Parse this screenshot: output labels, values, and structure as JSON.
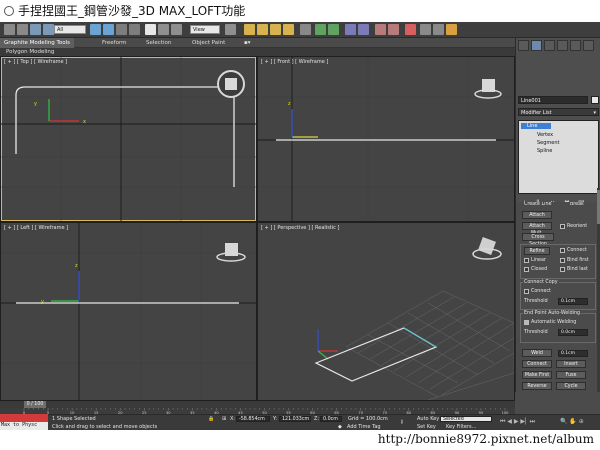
{
  "page_title": "手捏捏國王_鋼管沙發_3D MAX_LOFT功能",
  "toolbar": {
    "selection_filter": "All",
    "ref_coord": "View"
  },
  "ribbon": {
    "tabs": [
      "Graphite Modeling Tools",
      "Freeform",
      "Selection",
      "Object Paint"
    ],
    "active_tab_index": 0,
    "sub_label": "Polygon Modeling"
  },
  "viewports": {
    "top": "[ + ] [ Top ] [ Wireframe ]",
    "front": "[ + ] [ Front ] [ Wireframe ]",
    "left": "[ + ] [ Left ] [ Wireframe ]",
    "perspective": "[ + ] [ Perspective ] [ Realistic ]"
  },
  "command_panel": {
    "object_name": "Line001",
    "object_color": "#e8e8e8",
    "modifier_list": "Modifier List",
    "stack": [
      {
        "label": "Line",
        "selected": true
      },
      {
        "label": "Vertex",
        "selected": false
      },
      {
        "label": "Segment",
        "selected": false
      },
      {
        "label": "Spline",
        "selected": false
      }
    ],
    "partial_top_left": "Create Line",
    "partial_top_right": "Break",
    "attach": "Attach",
    "attach_mult": "Attach Mult.",
    "reorient": "Reorient",
    "cross_section": "Cross Section",
    "refine": "Refine",
    "connect": "Connect",
    "linear": "Linear",
    "bind_first": "Bind first",
    "closed": "Closed",
    "bind_last": "Bind last",
    "connect_copy": "Connect Copy",
    "connect_copy_cb": "Connect",
    "threshold": "Threshold",
    "threshold_val": "0.1cm",
    "end_point_welding": "End Point Auto-Welding",
    "automatic_welding": "Automatic Welding",
    "threshold2": "Threshold",
    "threshold2_val": "0.0cm",
    "weld": "Weld",
    "weld_val": "0.1cm",
    "connect_btn": "Connect",
    "insert": "Insert",
    "make_first": "Make First",
    "fuse": "Fuse",
    "reverse": "Reverse",
    "cycle": "Cycle",
    "crossinsert": "CrossInsert",
    "crossinsert_val": "0.1cm",
    "fillet": "Fillet",
    "fillet_val": "0.0cm",
    "chamfer": "Chamfer",
    "chamfer_val": "0.0cm",
    "outline": "Outline",
    "outline_val": "0.0cm",
    "center": "Center"
  },
  "timeline": {
    "frame": "0 / 100",
    "ticks": [
      "0",
      "5",
      "10",
      "15",
      "20",
      "25",
      "30",
      "35",
      "40",
      "45",
      "50",
      "55",
      "60",
      "65",
      "70",
      "75",
      "80",
      "85",
      "90",
      "95",
      "100"
    ]
  },
  "status": {
    "maxscript": "Max to Physc",
    "selected_count": "1 Shape Selected",
    "prompt": "Click and drag to select and move objects",
    "x_label": "X:",
    "x": "-58.854cm",
    "y_label": "Y:",
    "y": "121.033cm",
    "z_label": "Z:",
    "z": "0.0cm",
    "grid": "Grid = 100.0cm",
    "add_time_tag": "Add Time Tag",
    "auto_key": "Auto Key",
    "auto_key_mode": "Selected",
    "set_key": "Set Key",
    "key_filters": "Key Filters..."
  },
  "watermark": "http://bonnie8972.pixnet.net/album"
}
